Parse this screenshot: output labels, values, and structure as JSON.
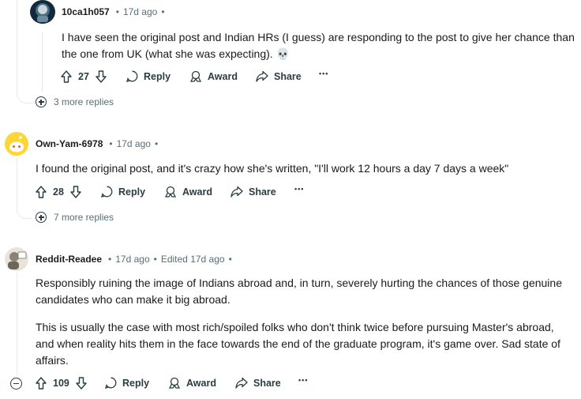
{
  "comments": [
    {
      "author": "10ca1h057",
      "time": "17d ago",
      "edited": "",
      "body": [
        "I have seen the original post and Indian HRs (I guess) are responding to the post to give her chance than",
        "the one from UK (what she was expecting). 💀"
      ],
      "score": "27",
      "more_replies": "3 more replies"
    },
    {
      "author": "Own-Yam-6978",
      "time": "17d ago",
      "edited": "",
      "body": [
        "I found the original post, and it's crazy how she's written, \"I'll work 12 hours a day 7 days a week\""
      ],
      "score": "28",
      "more_replies": "7 more replies"
    },
    {
      "author": "Reddit-Readee",
      "time": "17d ago",
      "edited": "Edited 17d ago",
      "body": [
        "Responsibly ruining the image of Indians abroad and, in turn, severely hurting the chances of those genuine",
        "candidates who can make it big abroad."
      ],
      "body2": [
        "This is usually the case with most rich/spoiled folks who don't think twice before pursuing Master's abroad,",
        "and when reality hits them in the face towards the end of the graduate program, it's game over. Sad state of",
        "affairs."
      ],
      "score": "109"
    }
  ],
  "actions": {
    "reply": "Reply",
    "award": "Award",
    "share": "Share",
    "overflow": "•••"
  },
  "separator": "•"
}
